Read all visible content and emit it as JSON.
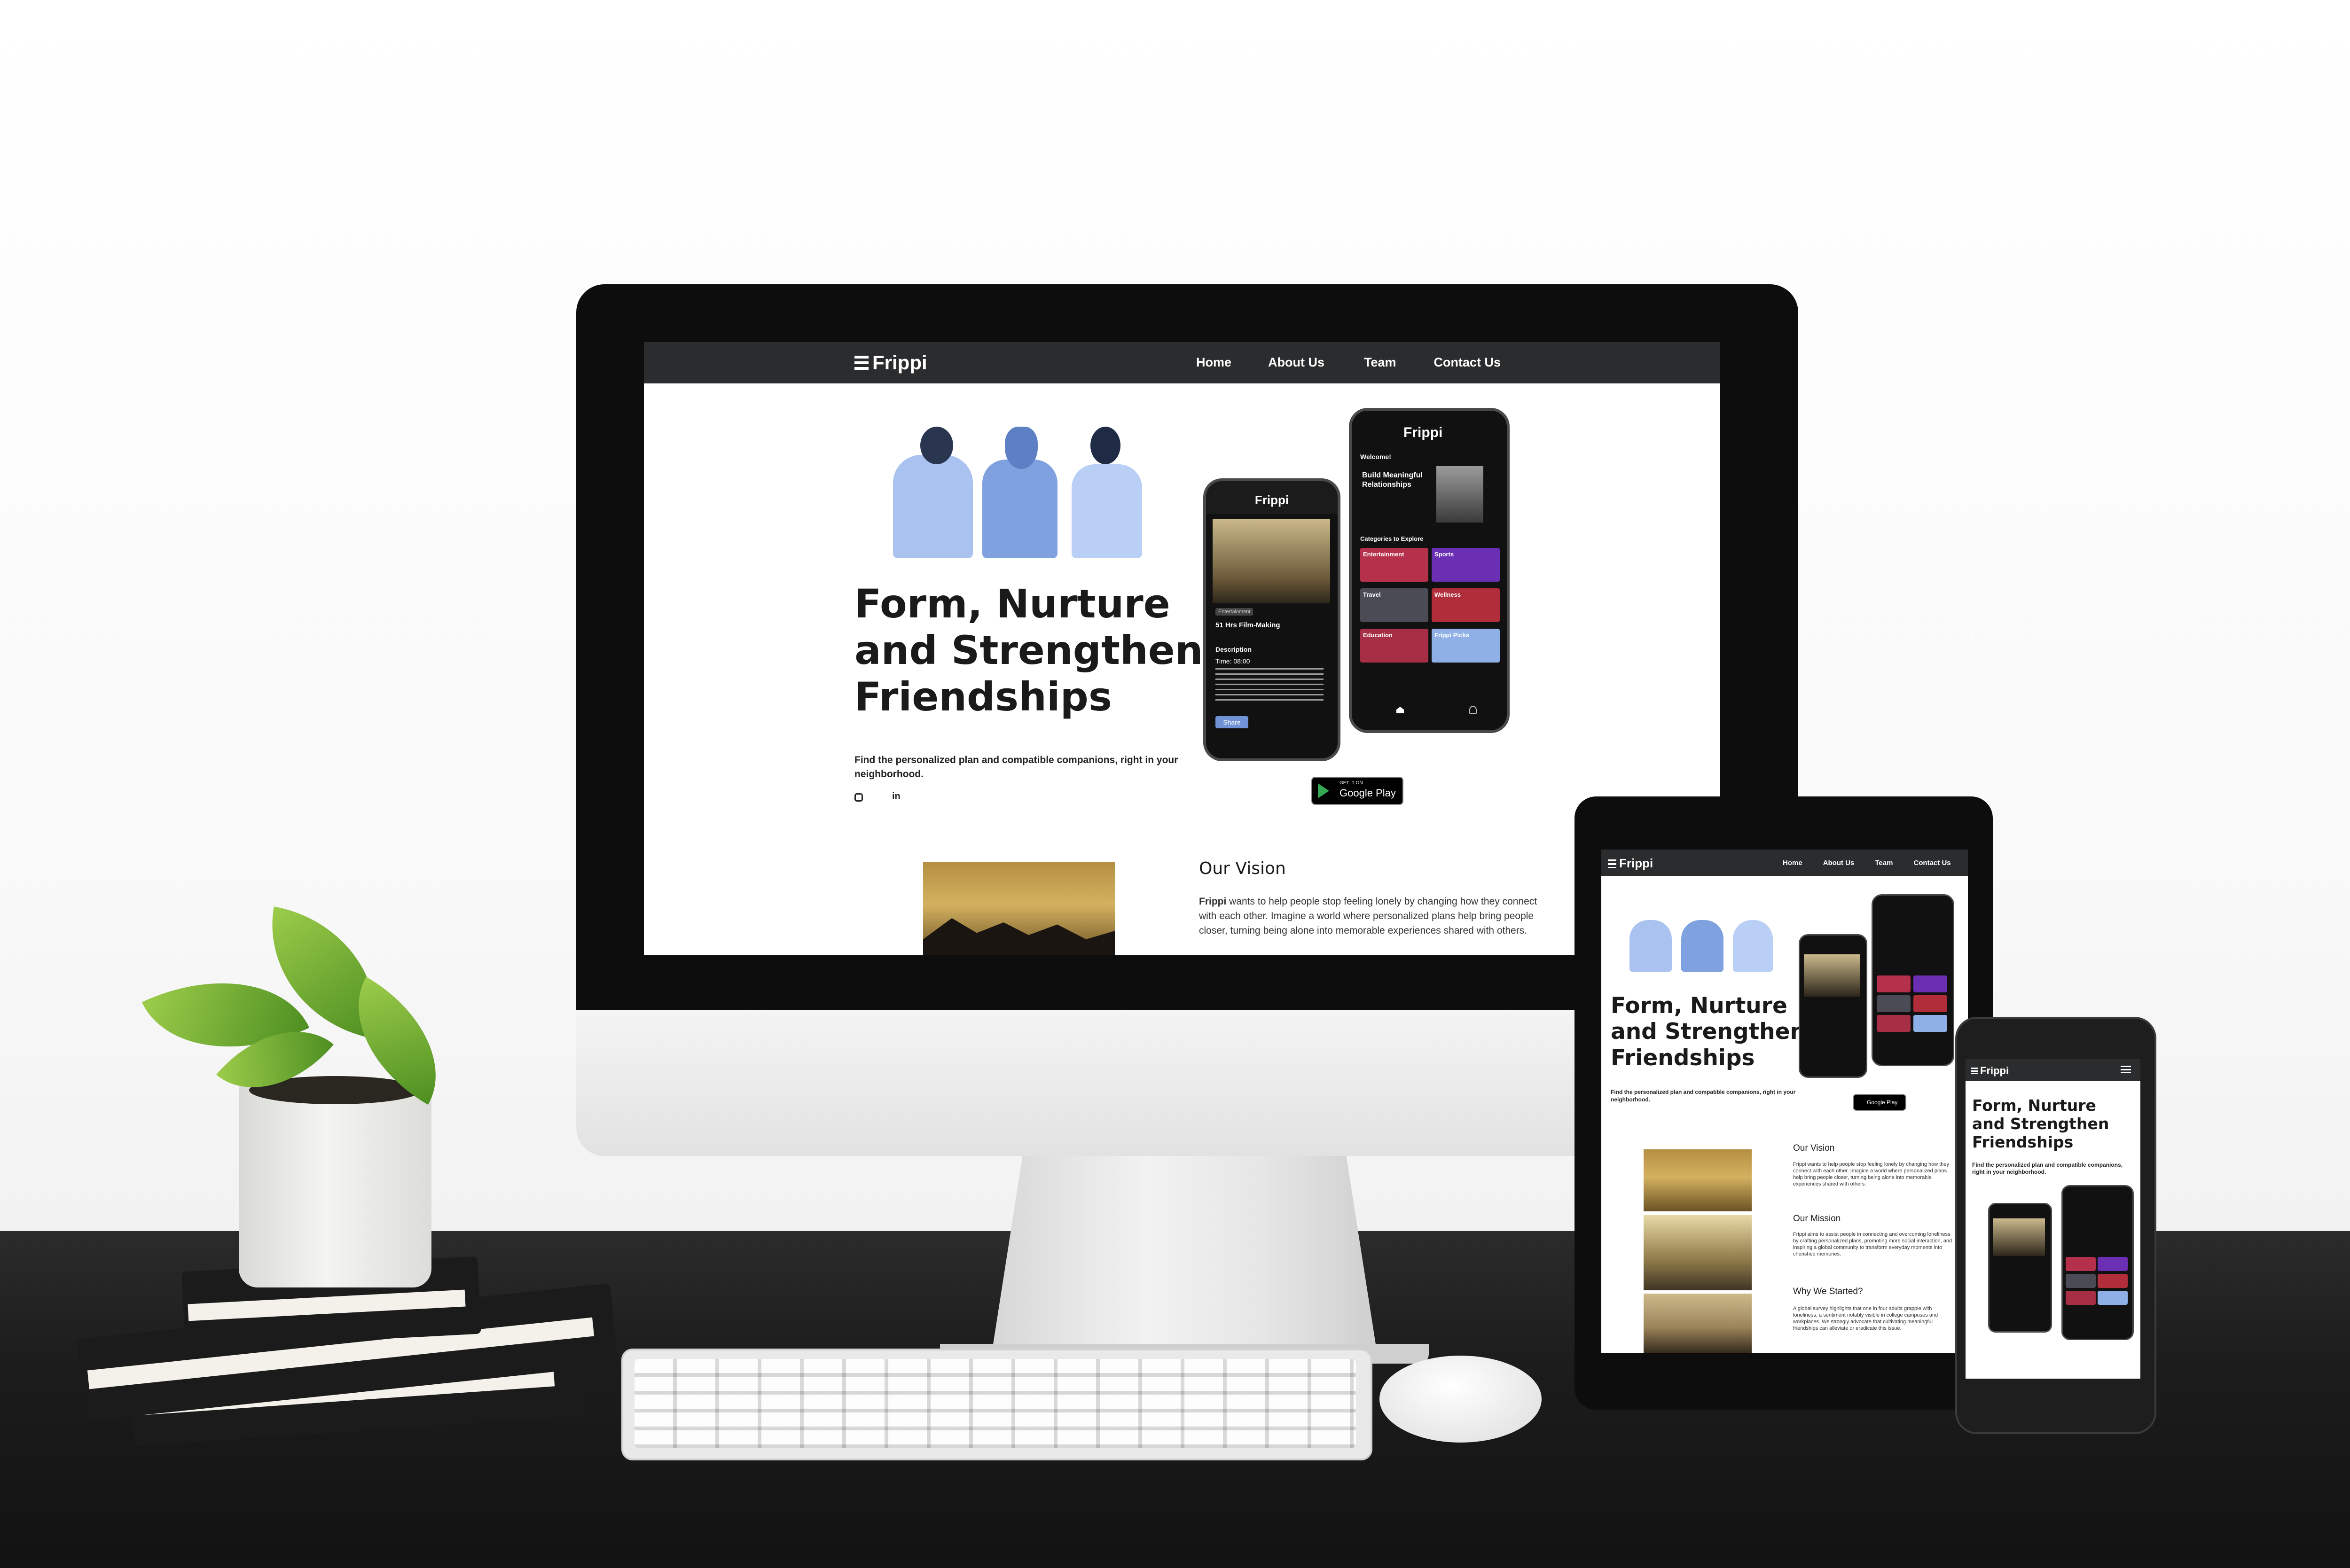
{
  "brand": {
    "name": "Frippi",
    "accent": "#6f93d6",
    "nav_bg": "#2b2c2e"
  },
  "nav": {
    "links": [
      "Home",
      "About Us",
      "Team",
      "Contact Us"
    ]
  },
  "hero": {
    "title_line1": "Form, Nurture",
    "title_line2": "and Strengthen",
    "title_line3": "Friendships",
    "subtitle": "Find the personalized plan and compatible companions, right in your neighborhood."
  },
  "social": {
    "icons": [
      "instagram-icon",
      "linkedin-icon"
    ],
    "linkedin_label": "in"
  },
  "store_badge": {
    "small": "GET IT ON",
    "big": "Google Play"
  },
  "app_screen": {
    "brand": "Frippi",
    "welcome": "Welcome!",
    "banner": "Build Meaningful Relationships",
    "categories_title": "Categories to Explore",
    "categories": [
      {
        "label": "Entertainment",
        "color": "#b5304a"
      },
      {
        "label": "Sports",
        "color": "#6b2fb3"
      },
      {
        "label": "Travel",
        "color": "#4b4b55"
      },
      {
        "label": "Wellness",
        "color": "#b22d3a"
      },
      {
        "label": "Education",
        "color": "#a62e45"
      },
      {
        "label": "Frippi Picks",
        "color": "#8fb0e6"
      }
    ]
  },
  "event_screen": {
    "tag": "Entertainment",
    "title": "51 Hrs Film-Making",
    "description_label": "Description",
    "time": "Time: 08:00",
    "button": "Share"
  },
  "vision": {
    "heading": "Our Vision",
    "brand_word": "Frippi",
    "text": " wants to help people stop feeling lonely by changing how they connect with each other. Imagine a world where personalized plans help bring people closer, turning being alone into memorable experiences shared with others."
  },
  "tablet": {
    "vision_heading": "Our Vision",
    "vision_text": "Frippi wants to help people stop feeling lonely by changing how they connect with each other. Imagine a world where personalized plans help bring people closer, turning being alone into memorable experiences shared with others.",
    "mission_heading": "Our Mission",
    "mission_text": "Frippi aims to assist people in connecting and overcoming loneliness by crafting personalized plans, promoting more social interaction, and inspiring a global community to transform everyday moments into cherished memories.",
    "why_heading": "Why We Started?",
    "why_text": "A global survey highlights that one in four adults grapple with loneliness, a sentiment notably visible in college campuses and workplaces. We strongly advocate that cultivating meaningful friendships can alleviate or eradicate this issue."
  }
}
